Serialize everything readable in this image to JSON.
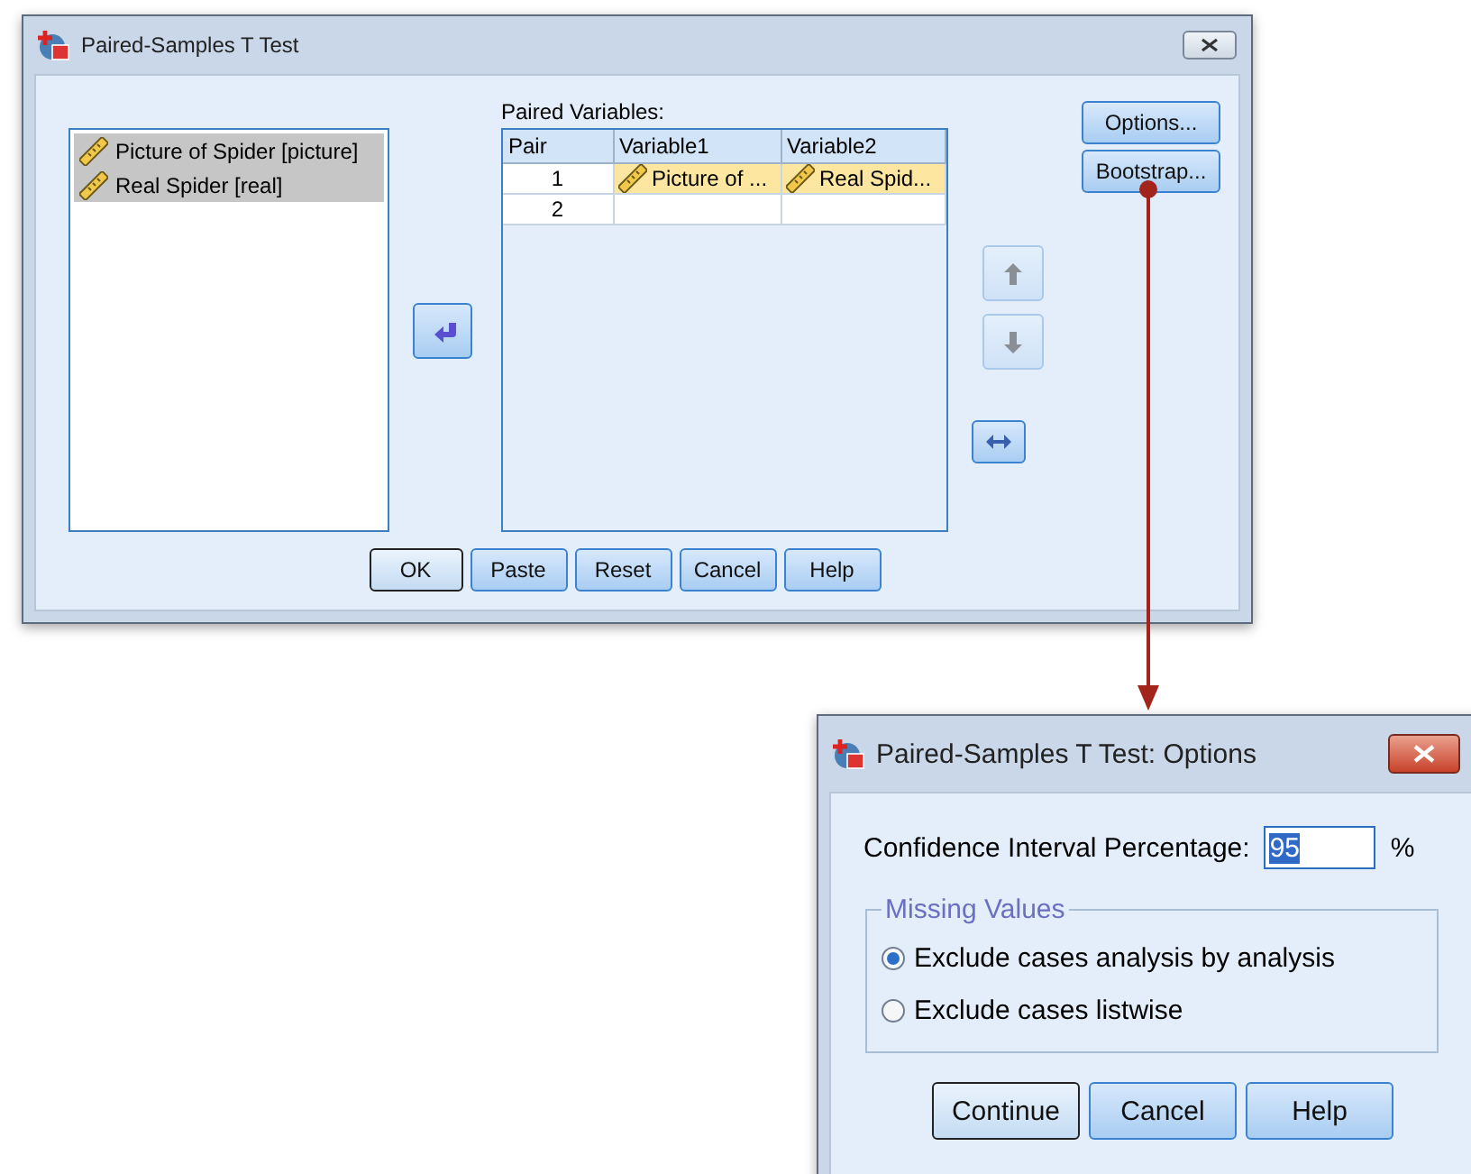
{
  "main_dialog": {
    "title": "Paired-Samples T Test",
    "source_variables": [
      {
        "label": "Picture of Spider [picture]",
        "selected": true
      },
      {
        "label": "Real Spider [real]",
        "selected": true
      }
    ],
    "paired_variables": {
      "label": "Paired Variables:",
      "columns": [
        "Pair",
        "Variable1",
        "Variable2"
      ],
      "rows": [
        {
          "pair": "1",
          "variable1": "Picture of ...",
          "variable2": "Real Spid...",
          "selected": true
        },
        {
          "pair": "2",
          "selected": false
        }
      ]
    },
    "move_up": {
      "disabled": true
    },
    "move_down": {
      "disabled": true
    },
    "side_buttons": [
      "Options...",
      "Bootstrap..."
    ],
    "buttons": [
      {
        "label": "OK",
        "default": true
      },
      {
        "label": "Paste",
        "default": false
      },
      {
        "label": "Reset",
        "default": false
      },
      {
        "label": "Cancel",
        "default": false
      },
      {
        "label": "Help",
        "default": false
      }
    ]
  },
  "options_dialog": {
    "title": "Paired-Samples T Test: Options",
    "confidence_label": "Confidence Interval Percentage:",
    "confidence_value": "95",
    "value_selected": true,
    "percent_sign": "%",
    "missing_values": {
      "legend": "Missing Values",
      "options": [
        {
          "label": "Exclude cases analysis by analysis",
          "selected": true
        },
        {
          "label": "Exclude cases listwise",
          "selected": false
        }
      ]
    },
    "buttons": [
      {
        "label": "Continue",
        "default": true
      },
      {
        "label": "Cancel",
        "default": false
      },
      {
        "label": "Help",
        "default": false
      }
    ]
  }
}
